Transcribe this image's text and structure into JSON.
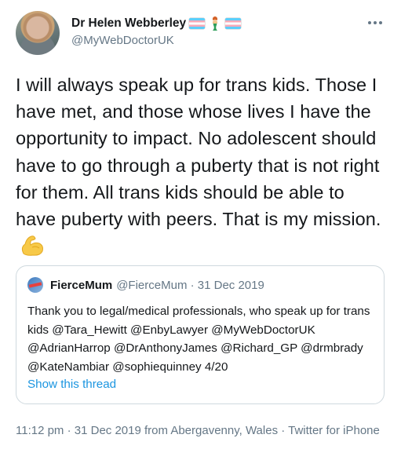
{
  "author": {
    "display_name": "Dr Helen Webberley",
    "handle": "@MyWebDoctorUK",
    "name_emoji_icons": [
      "transgender-flag-icon",
      "mermaid-icon",
      "transgender-flag-icon"
    ]
  },
  "tweet": {
    "text": "I will always speak up for trans kids. Those I have met, and those whose lives I have the opportunity to impact. No adolescent should have to go through a puberty that is not right for them. All trans kids should be able to have puberty with peers. That is my mission.",
    "trailing_emoji_icon": "flexed-biceps-icon"
  },
  "quoted_tweet": {
    "display_name": "FierceMum",
    "handle_and_date": "@FierceMum · 31 Dec 2019",
    "text": "Thank you to legal/medical professionals, who speak up for trans kids @Tara_Hewitt @EnbyLawyer @MyWebDoctorUK @AdrianHarrop @DrAnthonyJames @Richard_GP @drmbrady @KateNambiar @sophiequinney 4/20",
    "show_thread_label": "Show this thread"
  },
  "meta": {
    "timestamp_line": "11:12 pm · 31 Dec 2019 from Abergavenny, Wales · Twitter for iPhone"
  },
  "colors": {
    "link": "#1b95e0",
    "secondary_text": "#657786",
    "primary_text": "#14171a",
    "border": "#cfd9de"
  }
}
